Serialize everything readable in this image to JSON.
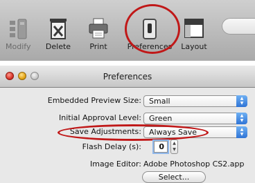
{
  "toolbar": {
    "items": [
      {
        "label": "Modify",
        "icon": "modify-icon",
        "enabled": false
      },
      {
        "label": "Delete",
        "icon": "trash-icon",
        "enabled": true
      },
      {
        "label": "Print",
        "icon": "printer-icon",
        "enabled": true
      },
      {
        "label": "Preferences",
        "icon": "switch-icon",
        "enabled": true,
        "highlighted": true
      },
      {
        "label": "Layout",
        "icon": "layout-icon",
        "enabled": true
      }
    ]
  },
  "window": {
    "title": "Preferences",
    "traffic_lights": [
      "close",
      "minimize",
      "zoom"
    ]
  },
  "prefs": {
    "embedded_preview_size": {
      "label": "Embedded Preview Size:",
      "value": "Small"
    },
    "initial_approval_level": {
      "label": "Initial Approval Level:",
      "value": "Green"
    },
    "save_adjustments": {
      "label": "Save Adjustments:",
      "value": "Always Save",
      "highlighted": true
    },
    "flash_delay": {
      "label": "Flash Delay (s):",
      "value": "0"
    },
    "image_editor": {
      "label": "Image Editor:",
      "value": "Adobe Photoshop CS2.app"
    },
    "select_button": "Select..."
  },
  "colors": {
    "annotation": "#c01818",
    "popup_arrow_blue": "#2f74d6",
    "toolbar_top": "#cfcfcf",
    "pane_bg": "#e8e8e8"
  }
}
